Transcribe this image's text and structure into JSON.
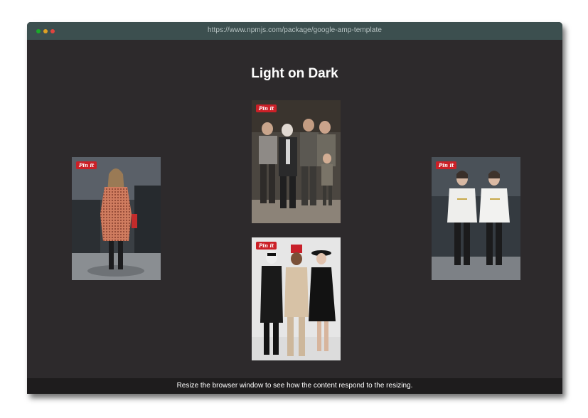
{
  "browser": {
    "url": "https://www.npmjs.com/package/google-amp-template",
    "buttons": [
      {
        "name": "close",
        "color": "#e0443e"
      },
      {
        "name": "minimize",
        "color": "#dea123"
      },
      {
        "name": "maximize",
        "color": "#1aab29"
      }
    ]
  },
  "page": {
    "title": "Light on Dark",
    "background": "#2d2a2c"
  },
  "gallery": {
    "pin_label": "Pin it",
    "pin_color": "#cb2027"
  },
  "footer": {
    "text": "Resize the browser window to see how the content respond to the resizing."
  }
}
